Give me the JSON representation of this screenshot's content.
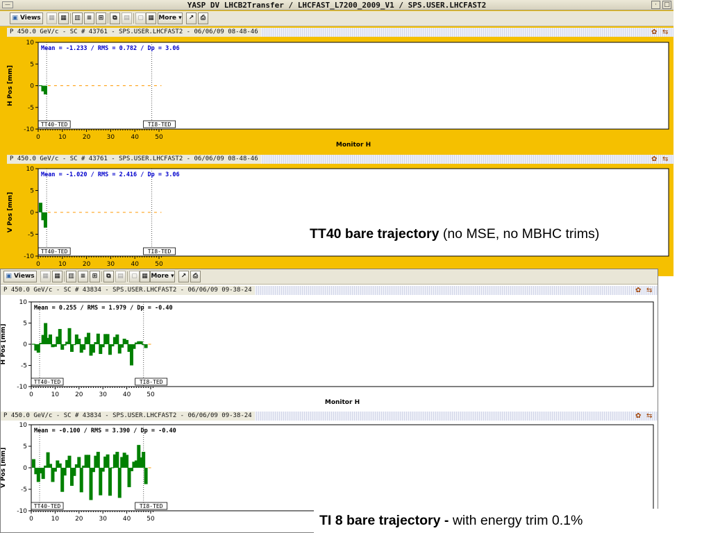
{
  "window1": {
    "title": "YASP DV LHCB2Transfer / LHCFAST_L7200_2009_V1 / SPS.USER.LHCFAST2",
    "toolbar": {
      "views_label": "Views",
      "more_label": "More"
    }
  },
  "window2": {
    "toolbar": {
      "views_label": "Views",
      "more_label": "More"
    }
  },
  "annotations": {
    "tt40_bold": "TT40 bare trajectory",
    "tt40_rest": " (no MSE, no MBHC trims)",
    "ti8_bold": "TI 8 bare trajectory -",
    "ti8_rest": " with energy trim 0.1%"
  },
  "colors": {
    "bar": "#008000",
    "reference_line": "#ff9900",
    "stats_text": "#0000cc",
    "panel_bg": "#f5c000"
  },
  "icons": [
    "menu-icon",
    "minimize-icon",
    "maximize-icon",
    "views-icon",
    "layout-icon",
    "list-icon",
    "zoom-icon",
    "print-icon",
    "panel-settings-icon"
  ],
  "chart_data": [
    {
      "id": "tt40_h",
      "type": "bar",
      "header": "P 450.0 GeV/c - SC # 43761 - SPS.USER.LHCFAST2 - 06/06/09 08-48-46",
      "stats": "Mean =  -1.233 / RMS =   0.782 / Dp =   3.06",
      "ylabel": "H Pos [mm]",
      "xlabel": "Monitor H",
      "xlim": [
        0,
        52
      ],
      "ylim": [
        -10,
        10
      ],
      "x_ticks": [
        0,
        10,
        20,
        30,
        40,
        50
      ],
      "y_ticks": [
        10,
        5,
        0,
        -5,
        -10
      ],
      "markers": [
        {
          "x": 3.5,
          "label": "TT40-TED"
        },
        {
          "x": 47,
          "label": "TI8-TED"
        }
      ],
      "x": [
        1,
        2,
        3
      ],
      "values": [
        0,
        -1.3,
        -2.0
      ],
      "reference_from": 4,
      "reference_to": 51
    },
    {
      "id": "tt40_v",
      "type": "bar",
      "header": "P 450.0 GeV/c - SC # 43761 - SPS.USER.LHCFAST2 - 06/06/09 08-48-46",
      "stats": "Mean =  -1.020 / RMS =   2.416 / Dp =   3.06",
      "ylabel": "V Pos [mm]",
      "xlabel": "",
      "xlim": [
        0,
        52
      ],
      "ylim": [
        -10,
        10
      ],
      "x_ticks": [
        0,
        10,
        20,
        30,
        40,
        50
      ],
      "y_ticks": [
        10,
        5,
        0,
        -5,
        -10
      ],
      "markers": [
        {
          "x": 3.5,
          "label": "TT40-TED"
        },
        {
          "x": 47,
          "label": "TI8-TED"
        }
      ],
      "x": [
        1,
        2,
        3
      ],
      "values": [
        2.2,
        -1.8,
        -3.5
      ],
      "reference_from": 4,
      "reference_to": 51
    },
    {
      "id": "ti8_h",
      "type": "bar",
      "header": "P 450.0 GeV/c - SC # 43834 - SPS.USER.LHCFAST2 - 06/06/09 09-38-24",
      "stats": "Mean =   0.255 / RMS =   1.979 / Dp =  -0.40",
      "ylabel": "H Pos [mm]",
      "xlabel": "Monitor H",
      "xlim": [
        0,
        52
      ],
      "ylim": [
        -10,
        10
      ],
      "x_ticks": [
        0,
        10,
        20,
        30,
        40,
        50
      ],
      "y_ticks": [
        10,
        5,
        0,
        -5,
        -10
      ],
      "markers": [
        {
          "x": 3.5,
          "label": "TT40-TED"
        },
        {
          "x": 47,
          "label": "TI8-TED"
        }
      ],
      "x": [
        1,
        2,
        3,
        4,
        5,
        6,
        7,
        8,
        9,
        10,
        11,
        12,
        13,
        14,
        15,
        16,
        17,
        18,
        19,
        20,
        21,
        22,
        23,
        24,
        25,
        26,
        27,
        28,
        29,
        30,
        31,
        32,
        33,
        34,
        35,
        36,
        37,
        38,
        39,
        40,
        41,
        42,
        43,
        44,
        45,
        46,
        47,
        48
      ],
      "values": [
        0,
        -1.5,
        -2,
        0.3,
        2.2,
        5,
        1.5,
        2.3,
        -0.7,
        -0.6,
        1.8,
        3.6,
        -1.3,
        -0.3,
        0.6,
        3.8,
        -1.8,
        -0.1,
        2.3,
        1.3,
        -2,
        -1.3,
        1.7,
        2.7,
        -2.7,
        -2,
        0.5,
        2.5,
        -2.3,
        -0.7,
        2.4,
        2.4,
        -2.5,
        -0.5,
        1.7,
        2.3,
        -2.2,
        -0.8,
        1.3,
        1,
        -1.8,
        -5,
        -1.1,
        0.4,
        0.7,
        0.7,
        -0.1,
        -0.9
      ],
      "reference_from": 49,
      "reference_to": 51
    },
    {
      "id": "ti8_v",
      "type": "bar",
      "header": "P 450.0 GeV/c - SC # 43834 - SPS.USER.LHCFAST2 - 06/06/09 09-38-24",
      "stats": "Mean =  -0.100 / RMS =   3.390 / Dp =  -0.40",
      "ylabel": "V Pos [mm]",
      "xlabel": "",
      "xlim": [
        0,
        52
      ],
      "ylim": [
        -10,
        10
      ],
      "x_ticks": [
        0,
        10,
        20,
        30,
        40,
        50
      ],
      "y_ticks": [
        10,
        5,
        0,
        -5,
        -10
      ],
      "markers": [
        {
          "x": 3.5,
          "label": "TT40-TED"
        },
        {
          "x": 47,
          "label": "TI8-TED"
        }
      ],
      "x": [
        1,
        2,
        3,
        4,
        5,
        6,
        7,
        8,
        9,
        10,
        11,
        12,
        13,
        14,
        15,
        16,
        17,
        18,
        19,
        20,
        21,
        22,
        23,
        24,
        25,
        26,
        27,
        28,
        29,
        30,
        31,
        32,
        33,
        34,
        35,
        36,
        37,
        38,
        39,
        40,
        41,
        42,
        43,
        44,
        45,
        46,
        47,
        48
      ],
      "values": [
        2,
        -1.5,
        -3.3,
        -1.3,
        -2.6,
        0.5,
        3.6,
        0.9,
        -3.3,
        -0.9,
        1.7,
        1,
        -5.6,
        -1.8,
        1.8,
        2.8,
        -4.2,
        -1.9,
        0.8,
        2.5,
        -5.7,
        0.5,
        3,
        3,
        -7.5,
        -1,
        2.8,
        3.7,
        -6.4,
        -0.9,
        2.6,
        3.1,
        -6.5,
        0,
        3.1,
        3.7,
        -7,
        2.5,
        3.5,
        3,
        -4.5,
        -0.8,
        1.4,
        1.7,
        5.3,
        2.4,
        3.7,
        -3.8
      ],
      "reference_from": 49,
      "reference_to": 51
    }
  ]
}
